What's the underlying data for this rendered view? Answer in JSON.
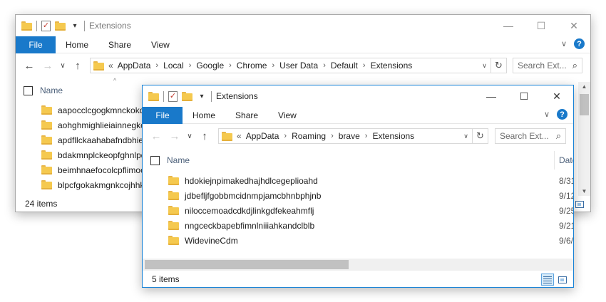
{
  "back_window": {
    "title": "Extensions",
    "ribbon": {
      "file": "File",
      "home": "Home",
      "share": "Share",
      "view": "View"
    },
    "address": {
      "lead": "«",
      "crumbs": [
        "AppData",
        "Local",
        "Google",
        "Chrome",
        "User Data",
        "Default",
        "Extensions"
      ]
    },
    "search_placeholder": "Search Ext...",
    "column_name": "Name",
    "rows": [
      "aapocclcgogkmnckokd",
      "aohghmighlieiainnegkc",
      "apdfllckaahabafndbhiea",
      "bdakmnplckeopfghnlpd",
      "beimhnaefocolcpflimoc",
      "blpcfgokakmgnkcojhhk"
    ],
    "status": "24 items"
  },
  "front_window": {
    "title": "Extensions",
    "ribbon": {
      "file": "File",
      "home": "Home",
      "share": "Share",
      "view": "View"
    },
    "address": {
      "lead": "«",
      "crumbs": [
        "AppData",
        "Roaming",
        "brave",
        "Extensions"
      ]
    },
    "search_placeholder": "Search Ext...",
    "column_name": "Name",
    "column_date": "Date",
    "rows": [
      {
        "name": "hdokiejnpimakedhajhdlcegeplioahd",
        "date": "8/31"
      },
      {
        "name": "jdbefljfgobbmcidnmpjamcbhnbphjnb",
        "date": "9/12"
      },
      {
        "name": "niloccemoadcdkdjlinkgdfekeahmflj",
        "date": "9/25"
      },
      {
        "name": "nngceckbapebfimnlniiiahkandclblb",
        "date": "9/21"
      },
      {
        "name": "WidevineCdm",
        "date": "9/6/"
      }
    ],
    "status": "5 items"
  },
  "colors": {
    "accent": "#1979ca",
    "active_border": "#1883d7",
    "folder": "#f5c94f",
    "column_header_text": "#4c607a"
  },
  "icons": {
    "back": "arrow-left-icon",
    "forward": "arrow-right-icon",
    "recent": "chevron-down-icon",
    "up": "arrow-up-icon",
    "refresh": "refresh-icon",
    "search": "magnifier-icon",
    "help": "help-icon",
    "folder": "folder-icon"
  }
}
